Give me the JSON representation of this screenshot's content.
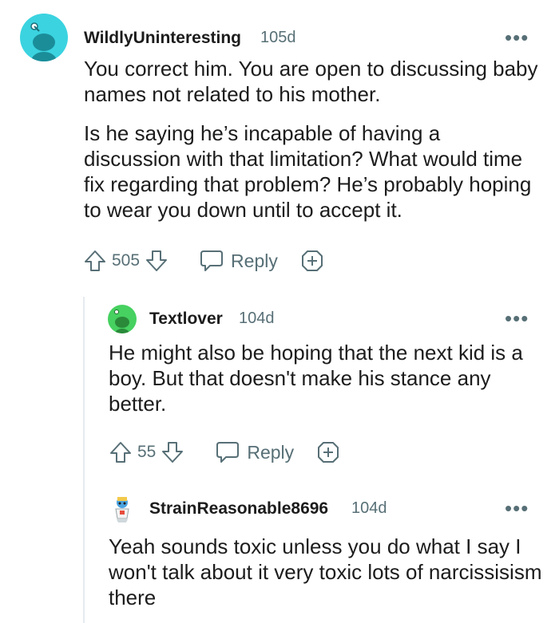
{
  "comments": [
    {
      "username": "WildlyUninteresting",
      "age": "105d",
      "more": "•••",
      "paragraphs": [
        "You correct him. You are open to discussing baby names not related to his mother.",
        "Is he saying he’s incapable of having a discussion with that limitation? What would time fix regarding that problem? He’s probably hoping to wear you down until to accept it."
      ],
      "score": "505",
      "reply_label": "Reply",
      "avatar_color": "#3bd3e0"
    },
    {
      "username": "Textlover",
      "age": "104d",
      "more": "•••",
      "paragraphs": [
        "He might also be hoping that the next kid is a boy. But that doesn't make his stance any better."
      ],
      "score": "55",
      "reply_label": "Reply",
      "avatar_color": "#46d160"
    },
    {
      "username": "StrainReasonable8696",
      "age": "104d",
      "more": "•••",
      "paragraphs": [
        "Yeah sounds toxic unless you do what I say I won't talk about it very toxic lots of narcissisism there"
      ]
    }
  ]
}
